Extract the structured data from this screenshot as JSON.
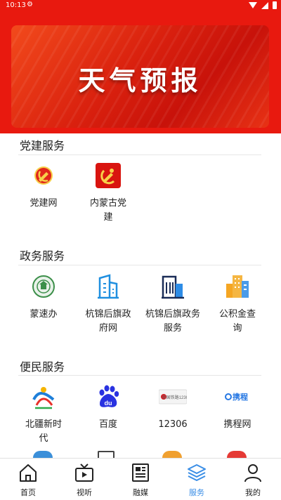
{
  "status": {
    "time": "10:13"
  },
  "banner": {
    "title": "天气预报"
  },
  "sections": [
    {
      "title": "党建服务",
      "items": [
        {
          "label": "党建网",
          "icon": "party-emblem-icon"
        },
        {
          "label": "内蒙古党建",
          "icon": "party-flag-icon"
        }
      ]
    },
    {
      "title": "政务服务",
      "items": [
        {
          "label": "蒙速办",
          "icon": "emblem-icon"
        },
        {
          "label": "杭锦后旗政府网",
          "icon": "building-icon"
        },
        {
          "label": "杭锦后旗政务服务",
          "icon": "government-building-icon"
        },
        {
          "label": "公积金查询",
          "icon": "housing-fund-icon"
        }
      ]
    },
    {
      "title": "便民服务",
      "items": [
        {
          "label": "北疆新时代",
          "icon": "beijiang-logo-icon"
        },
        {
          "label": "百度",
          "icon": "baidu-logo-icon"
        },
        {
          "label": "12306",
          "icon": "railway-logo-icon",
          "logo_text": "中国铁路12306"
        },
        {
          "label": "携程网",
          "icon": "ctrip-logo-icon",
          "logo_text": "携程"
        }
      ]
    }
  ],
  "nav": [
    {
      "label": "首页",
      "icon": "home-icon",
      "active": false
    },
    {
      "label": "视听",
      "icon": "tv-icon",
      "active": false
    },
    {
      "label": "融媒",
      "icon": "newspaper-icon",
      "active": false
    },
    {
      "label": "服务",
      "icon": "layers-icon",
      "active": true
    },
    {
      "label": "我的",
      "icon": "user-icon",
      "active": false
    }
  ],
  "colors": {
    "brand_red": "#e8190f",
    "nav_active": "#3a8ee6"
  }
}
